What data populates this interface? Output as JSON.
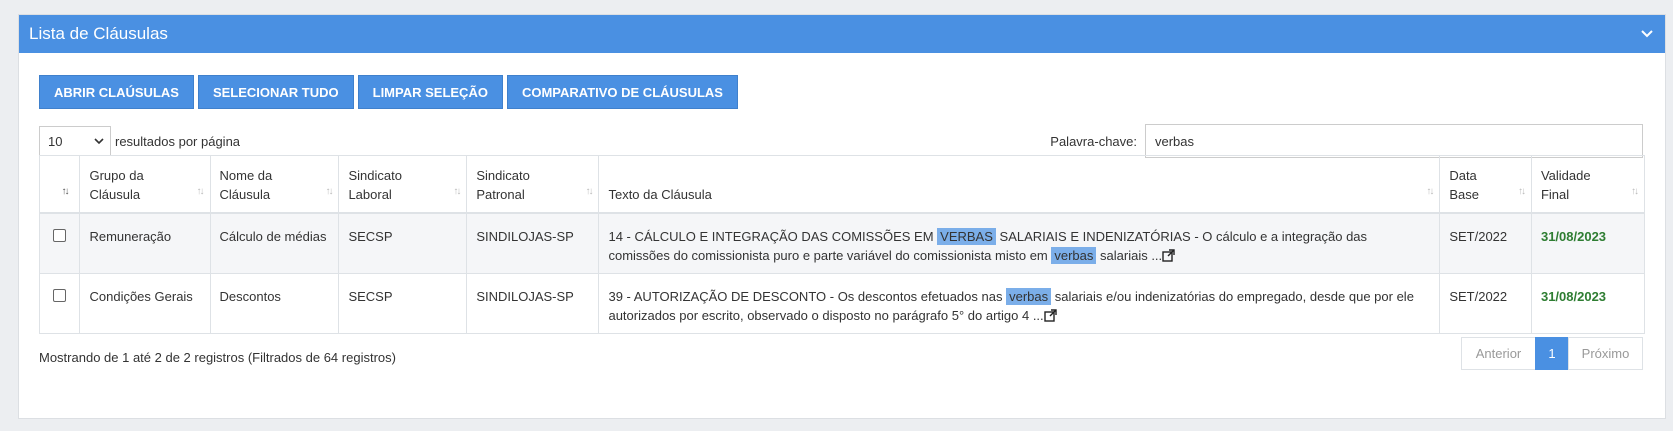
{
  "panel": {
    "title": "Lista de Cláusulas"
  },
  "toolbar": {
    "open_label": "ABRIR CLAÚSULAS",
    "select_all_label": "SELECIONAR TUDO",
    "clear_label": "LIMPAR SELEÇÃO",
    "compare_label": "COMPARATIVO DE CLÁUSULAS"
  },
  "length": {
    "value": "10",
    "label": "resultados por página"
  },
  "search": {
    "label": "Palavra-chave:",
    "value": "verbas"
  },
  "table": {
    "headers": {
      "grupo_l1": "Grupo da",
      "grupo_l2": "Cláusula",
      "nome_l1": "Nome da",
      "nome_l2": "Cláusula",
      "laboral_l1": "Sindicato",
      "laboral_l2": "Laboral",
      "patronal_l1": "Sindicato",
      "patronal_l2": "Patronal",
      "texto": "Texto da Cláusula",
      "database_l1": "Data",
      "database_l2": "Base",
      "validade_l1": "Validade",
      "validade_l2": "Final"
    },
    "rows": [
      {
        "grupo": "Remuneração",
        "nome": "Cálculo de médias",
        "laboral": "SECSP",
        "patronal": "SINDILOJAS-SP",
        "texto_a": "14 - CÁLCULO E INTEGRAÇÃO DAS COMISSÕES EM ",
        "texto_hl1": "VERBAS",
        "texto_b": " SALARIAIS E INDENIZATÓRIAS - O cálculo e a integração das comissões do comissionista puro e parte variável do comissionista misto em ",
        "texto_hl2": "verbas",
        "texto_c": " salariais ...",
        "data_base": "SET/2022",
        "validade": "31/08/2023"
      },
      {
        "grupo": "Condições Gerais",
        "nome": "Descontos",
        "laboral": "SECSP",
        "patronal": "SINDILOJAS-SP",
        "texto_a": "39 - AUTORIZAÇÃO DE DESCONTO - Os descontos efetuados nas ",
        "texto_hl1": "verbas",
        "texto_b": " salariais e/ou indenizatórias do empregado, desde que por ele autorizados por escrito, observado o disposto no parágrafo 5° do artigo 4 ...",
        "data_base": "SET/2022",
        "validade": "31/08/2023"
      }
    ]
  },
  "footer": {
    "info": "Mostrando de 1 até 2 de 2 registros (Filtrados de 64 registros)",
    "prev": "Anterior",
    "current": "1",
    "next": "Próximo"
  },
  "colors": {
    "header_blue": "#4a90e2",
    "highlight": "#7baee9",
    "validity_green": "#2e7d32"
  },
  "icons": [
    "chevron-down-icon",
    "sort-icon",
    "external-link-icon"
  ]
}
